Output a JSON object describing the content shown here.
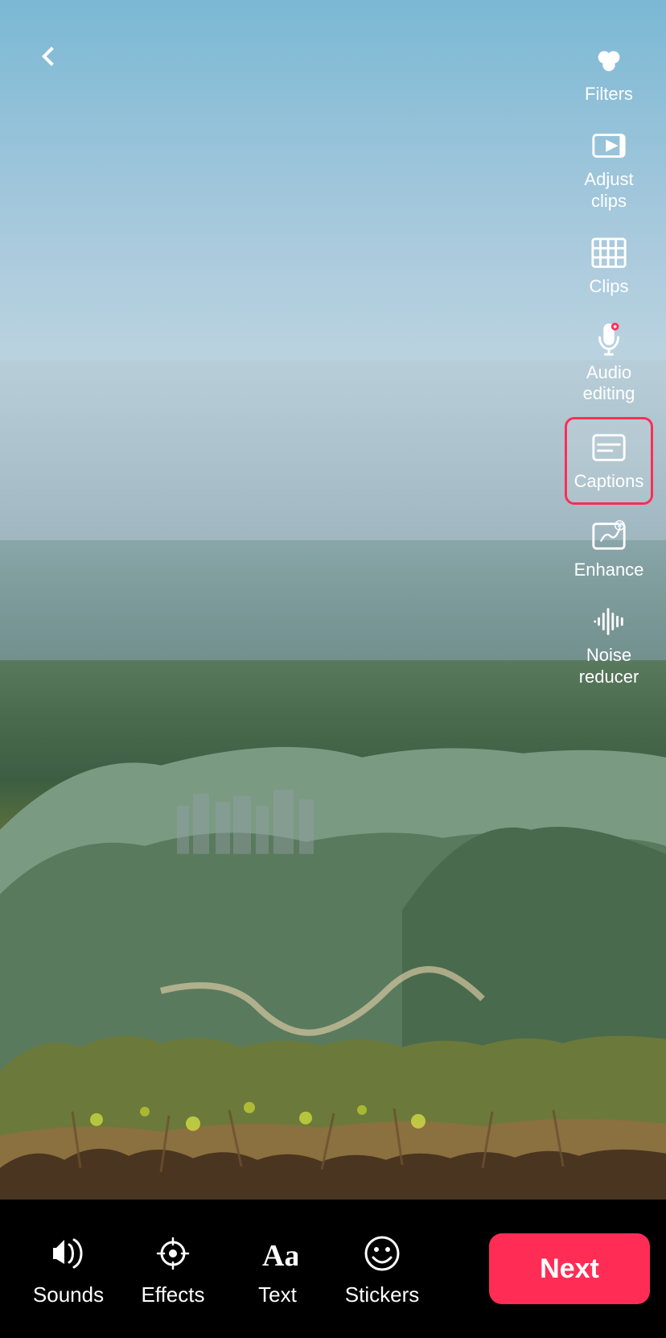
{
  "header": {
    "back_label": "‹"
  },
  "right_toolbar": {
    "items": [
      {
        "id": "filters",
        "label": "Filters",
        "active": false
      },
      {
        "id": "adjust-clips",
        "label": "Adjust clips",
        "active": false
      },
      {
        "id": "clips",
        "label": "Clips",
        "active": false
      },
      {
        "id": "audio-editing",
        "label": "Audio editing",
        "active": false
      },
      {
        "id": "captions",
        "label": "Captions",
        "active": true
      },
      {
        "id": "enhance",
        "label": "Enhance",
        "active": false
      },
      {
        "id": "noise-reducer",
        "label": "Noise reducer",
        "active": false
      }
    ]
  },
  "bottom_toolbar": {
    "items": [
      {
        "id": "sounds",
        "label": "Sounds"
      },
      {
        "id": "effects",
        "label": "Effects"
      },
      {
        "id": "text",
        "label": "Text"
      },
      {
        "id": "stickers",
        "label": "Stickers"
      }
    ],
    "next_button": "Next"
  }
}
